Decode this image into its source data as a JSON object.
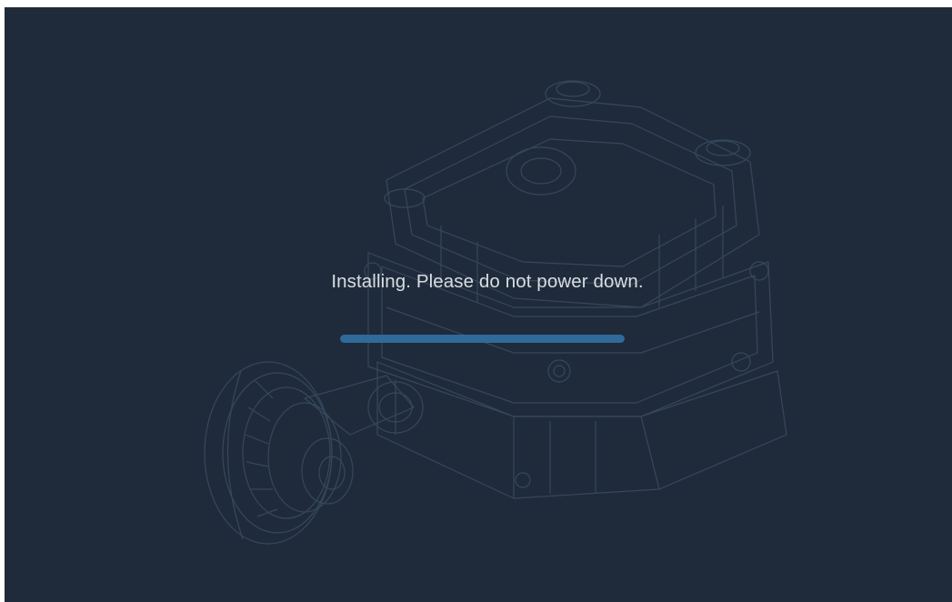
{
  "install_screen": {
    "message": "Installing. Please do not power down.",
    "progress_fraction": 1.0,
    "colors": {
      "background": "#1f2b3a",
      "text": "#d8dde3",
      "progress_bar": "#2f6a9a",
      "line_art": "#3b4d63"
    },
    "background_art_icon": "gearbox-motor-line-art"
  }
}
